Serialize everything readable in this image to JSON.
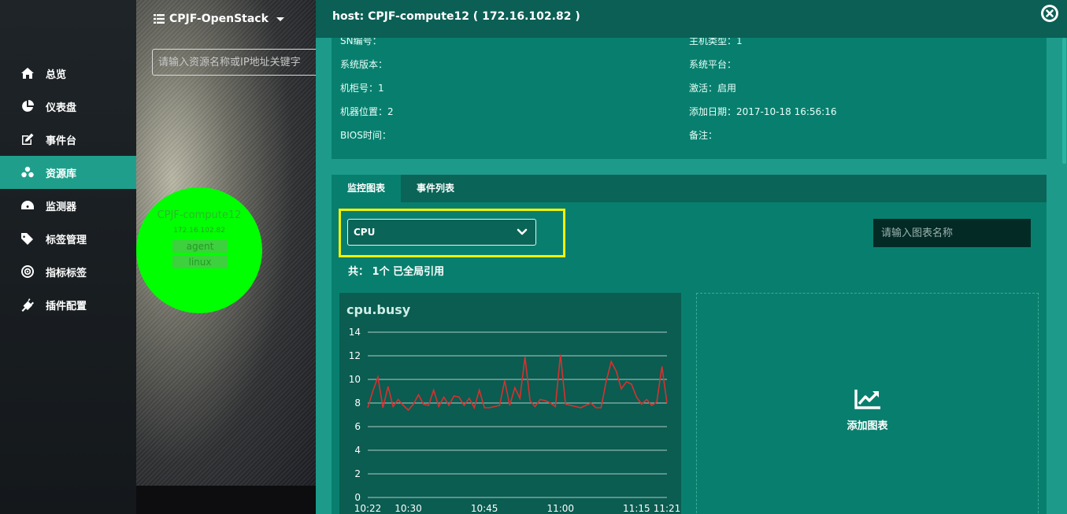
{
  "sidebar": {
    "items": [
      {
        "label": "总览",
        "icon": "home-icon"
      },
      {
        "label": "仪表盘",
        "icon": "pie-chart-icon"
      },
      {
        "label": "事件台",
        "icon": "edit-icon"
      },
      {
        "label": "资源库",
        "icon": "cubes-icon",
        "active": true
      },
      {
        "label": "监测器",
        "icon": "dashboard-icon"
      },
      {
        "label": "标签管理",
        "icon": "tags-icon"
      },
      {
        "label": "指标标签",
        "icon": "bullseye-icon"
      },
      {
        "label": "插件配置",
        "icon": "plug-icon"
      }
    ]
  },
  "topology": {
    "project_name": "CPJF-OpenStack",
    "search_placeholder": "请输入资源名称或IP地址关键字",
    "node": {
      "name": "CPJF-compute12",
      "ip": "172.16.102.82",
      "tags": [
        "agent",
        "linux"
      ],
      "color": "#00ff00"
    }
  },
  "drawer": {
    "title": "host: CPJF-compute12 ( 172.16.102.82 )",
    "info": [
      {
        "label": "SN编号：",
        "value": ""
      },
      {
        "label": "主机类型：",
        "value": "1"
      },
      {
        "label": "系统版本：",
        "value": ""
      },
      {
        "label": "系统平台：",
        "value": ""
      },
      {
        "label": "机柜号：",
        "value": "1"
      },
      {
        "label": "激活：",
        "value": "启用"
      },
      {
        "label": "机器位置：",
        "value": "2"
      },
      {
        "label": "添加日期：",
        "value": "2017-10-18 16:56:16"
      },
      {
        "label": "BIOS时间：",
        "value": ""
      },
      {
        "label": "备注：",
        "value": ""
      }
    ],
    "tabs": [
      "监控图表",
      "事件列表"
    ],
    "active_tab": 0,
    "metric_select": "CPU",
    "chart_search_placeholder": "请输入图表名称",
    "count_text": "共： 1个 已全局引用",
    "add_chart_label": "添加图表"
  },
  "colors": {
    "accent": "#1f9f8b",
    "panel": "#087f6e",
    "header": "#0b5f55",
    "line": "#d8312f",
    "highlight": "#f2f200"
  },
  "chart_data": {
    "type": "line",
    "title": "cpu.busy",
    "ylim": [
      0,
      14
    ],
    "yticks": [
      0,
      2,
      4,
      6,
      8,
      10,
      12,
      14
    ],
    "xticks": [
      "10:22",
      "10:30",
      "10:45",
      "11:00",
      "11:15",
      "11:21"
    ],
    "grid": true,
    "series": [
      {
        "values": [
          7.6,
          9.0,
          10.2,
          7.6,
          9.4,
          7.7,
          8.3,
          7.8,
          7.4,
          7.9,
          8.7,
          7.9,
          7.8,
          9.1,
          7.7,
          8.5,
          7.8,
          8.6,
          8.5,
          7.8,
          8.4,
          7.6,
          9.1,
          7.6,
          7.6,
          7.7,
          7.8,
          9.9,
          7.8,
          9.3,
          8.4,
          11.9,
          8.2,
          7.7,
          8.3,
          8.2,
          8.0,
          7.7,
          12.1,
          7.9,
          7.8,
          7.7,
          7.6,
          7.8,
          8.0,
          7.6,
          7.6,
          9.8,
          11.5,
          10.7,
          9.2,
          9.8,
          9.6,
          8.5,
          7.9,
          8.3,
          7.8,
          8.1,
          11.1,
          8.0
        ]
      }
    ]
  }
}
